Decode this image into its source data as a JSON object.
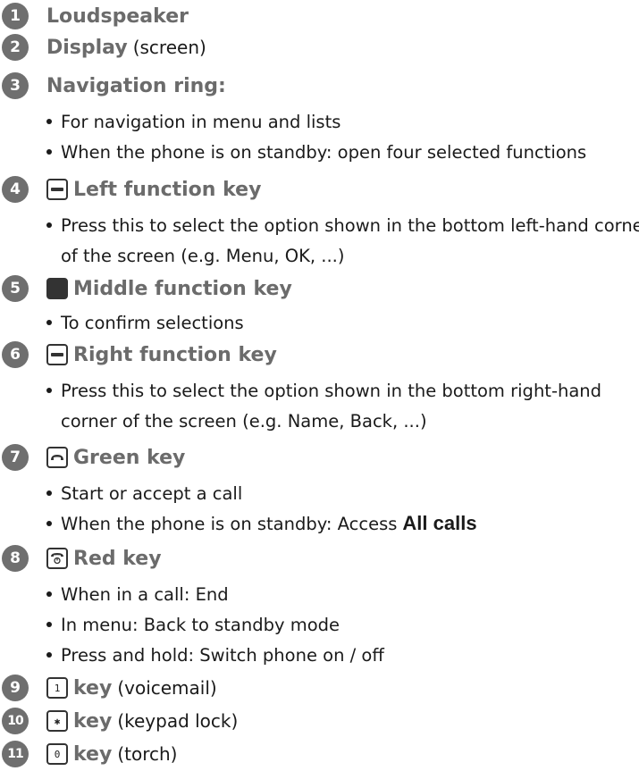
{
  "items": [
    {
      "num": "1",
      "title": "Loudspeaker"
    },
    {
      "num": "2",
      "title": "Display",
      "plain": "(screen)"
    },
    {
      "num": "3",
      "title": "Navigation ring:",
      "bullets": [
        "For navigation in menu and lists",
        "When the phone is on standby: open four selected functions"
      ]
    },
    {
      "num": "4",
      "icon": "minus-key-icon",
      "title": "Left function key",
      "bullet": "Press this to select the option shown in the bottom left-hand corner",
      "cont": "of the screen (e.g. Menu, OK, ...)"
    },
    {
      "num": "5",
      "icon": "filled-square-key-icon",
      "title": "Middle function key",
      "bullet": "To confirm selections"
    },
    {
      "num": "6",
      "icon": "minus-key-icon",
      "title": "Right function key",
      "bullet": "Press this to select the option shown in the bottom right-hand",
      "cont": "corner of the screen (e.g. Name, Back, ...)"
    },
    {
      "num": "7",
      "icon": "handset-key-icon",
      "title": "Green key",
      "bullets": [
        "Start or accept a call"
      ],
      "bullet2_pre": "When the phone is on standby: Access",
      "bullet2_strong": "All calls"
    },
    {
      "num": "8",
      "icon": "red-end-key-icon",
      "title": "Red key",
      "bullets": [
        "When in a call: End",
        "In menu: Back to standby mode",
        "Press and hold: Switch phone on / off"
      ]
    },
    {
      "num": "9",
      "icon": "one-voicemail-key-icon",
      "keyglyph": "1",
      "title": "key",
      "plain": "(voicemail)"
    },
    {
      "num": "10",
      "icon": "star-keypad-lock-key-icon",
      "keyglyph": "✱",
      "title": "key",
      "plain": "(keypad lock)"
    },
    {
      "num": "11",
      "icon": "zero-torch-key-icon",
      "keyglyph": "0",
      "title": "key",
      "plain": "(torch)"
    }
  ]
}
